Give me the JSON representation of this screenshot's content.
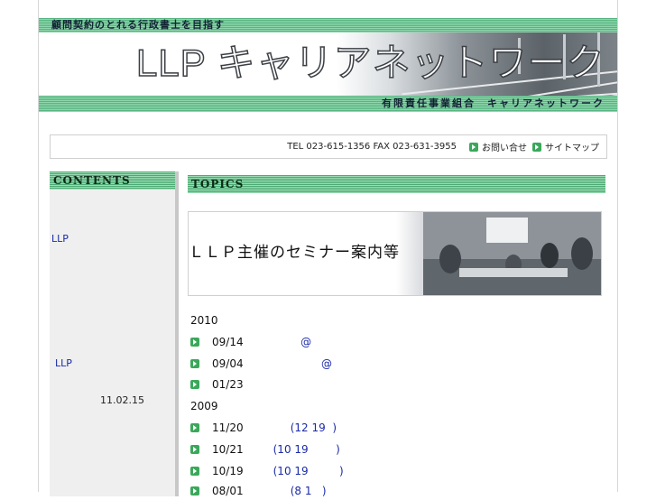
{
  "header": {
    "tagline": "顧問契約のとれる行政書士を目指す",
    "logo": "LLP キャリアネットワーク",
    "org_name": "有限責任事業組合　キャリアネットワーク"
  },
  "contact": {
    "tel_fax": "TEL 023-615-1356 FAX 023-631-3955",
    "links": [
      "お問い合せ",
      "サイトマップ"
    ]
  },
  "sidebar": {
    "heading": "CONTENTS",
    "link1": "LLP",
    "link2": "LLP",
    "date": "11.02.15"
  },
  "main": {
    "heading": "TOPICS",
    "banner_text": "ＬＬＰ主催のセミナー案内等",
    "years": [
      "2010",
      "2009"
    ],
    "items_2010": [
      {
        "date": "09/14",
        "title": "          @"
      },
      {
        "date": "09/04",
        "title": "                @"
      },
      {
        "date": "01/23",
        "title": ""
      }
    ],
    "items_2009": [
      {
        "date": "11/20",
        "title": "       (12 19  )"
      },
      {
        "date": "10/21",
        "title": "  (10 19        )"
      },
      {
        "date": "10/19",
        "title": "  (10 19         )"
      },
      {
        "date": "08/01",
        "title": "       (8 1   )"
      }
    ]
  },
  "colors": {
    "band_green": "#58b582",
    "link_blue": "#1a2aa8",
    "arrow_green": "#3aa85a"
  }
}
